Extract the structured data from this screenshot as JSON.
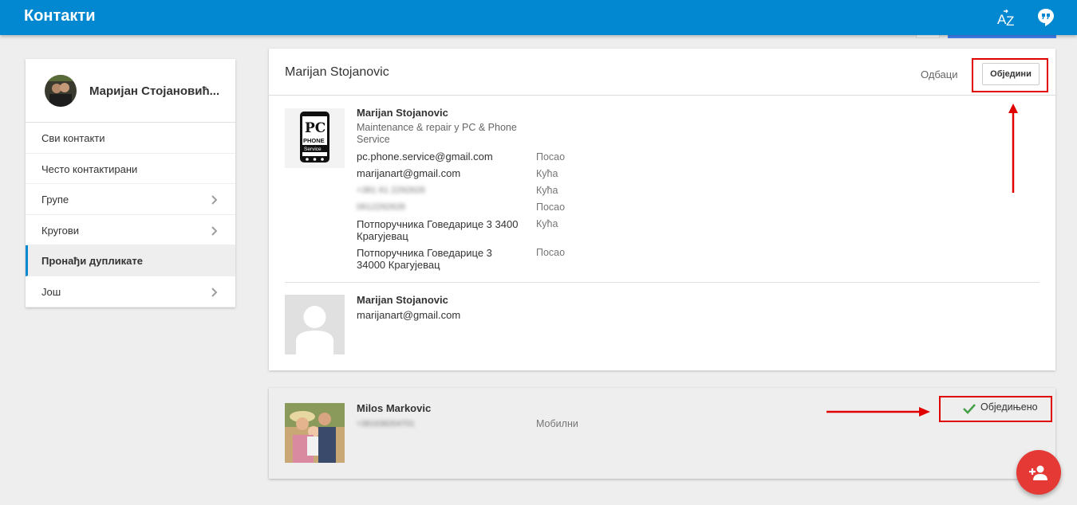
{
  "header": {
    "title": "Контакти",
    "sort_icon": "az-sort-icon",
    "hangouts_icon": "hangouts-icon",
    "color": "#0288d1"
  },
  "sidebar": {
    "profile_name": "Маријан Стојановић...",
    "items": [
      {
        "label": "Сви контакти",
        "has_chevron": false
      },
      {
        "label": "Често контактирани",
        "has_chevron": false
      },
      {
        "label": "Групе",
        "has_chevron": true
      },
      {
        "label": "Кругови",
        "has_chevron": true
      },
      {
        "label": "Пронађи дупликате",
        "has_chevron": false,
        "active": true
      },
      {
        "label": "Још",
        "has_chevron": true
      }
    ]
  },
  "duplicate_group": {
    "title": "Marijan Stojanovic",
    "dismiss_label": "Одбаци",
    "merge_label": "Обједини",
    "contact_a": {
      "name": "Marijan Stojanovic",
      "subtitle": "Maintenance & repair у PC & Phone Service",
      "logo_text": [
        "PC",
        "PHONE",
        "Service"
      ],
      "rows": [
        {
          "value": "pc.phone.service@gmail.com",
          "type": "Посао",
          "blurred": false
        },
        {
          "value": "marijanart@gmail.com",
          "type": "Кућа",
          "blurred": false
        },
        {
          "value": "+381 61 2292626",
          "type": "Кућа",
          "blurred": true
        },
        {
          "value": "0612292626",
          "type": "Посао",
          "blurred": true
        },
        {
          "value": "Потпоручника Говедарице 3 3400 Крагујевац",
          "type": "Кућа",
          "blurred": false
        },
        {
          "value": "Потпоручника Говедарице 3 34000 Крагујевац",
          "type": "Посао",
          "blurred": false
        }
      ]
    },
    "contact_b": {
      "name": "Marijan Stojanovic",
      "email": "marijanart@gmail.com"
    }
  },
  "merged_group": {
    "name": "Milos Markovic",
    "phone": "+381638204701",
    "phone_type": "Мобилни",
    "status_label": "Обједињено"
  },
  "fab": {
    "icon": "add-person-icon",
    "color": "#e53935"
  },
  "annotation_color": "#e00000"
}
